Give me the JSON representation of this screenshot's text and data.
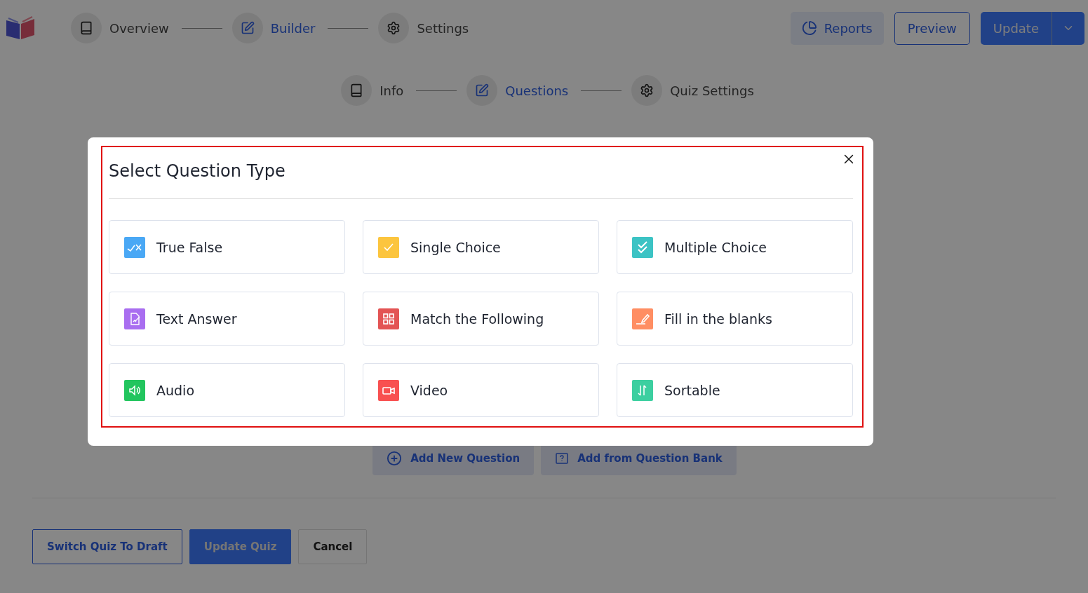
{
  "steps": [
    {
      "label": "Overview",
      "selected": false
    },
    {
      "label": "Builder",
      "selected": true
    },
    {
      "label": "Settings",
      "selected": false
    }
  ],
  "header_buttons": {
    "reports": "Reports",
    "preview": "Preview",
    "update": "Update"
  },
  "sub_steps": [
    {
      "label": "Info",
      "selected": false
    },
    {
      "label": "Questions",
      "selected": true
    },
    {
      "label": "Quiz Settings",
      "selected": false
    }
  ],
  "question_actions": [
    {
      "label": "Add New Question",
      "kind": "add"
    },
    {
      "label": "Add from Question Bank",
      "kind": "bank"
    }
  ],
  "footer_buttons": [
    {
      "label": "Switch Quiz To Draft",
      "kind": "outline"
    },
    {
      "label": "Update Quiz",
      "kind": "primary"
    },
    {
      "label": "Cancel",
      "kind": "plain"
    }
  ],
  "modal": {
    "title": "Select Question Type",
    "question_types": [
      {
        "label": "True False",
        "kind": "true_false",
        "color": "#4aa8f5"
      },
      {
        "label": "Single Choice",
        "kind": "single",
        "color": "#fcc53e"
      },
      {
        "label": "Multiple Choice",
        "kind": "multiple",
        "color": "#3cc3c4"
      },
      {
        "label": "Text Answer",
        "kind": "text",
        "color": "#a96ef0"
      },
      {
        "label": "Match the Following",
        "kind": "match",
        "color": "#e35454"
      },
      {
        "label": "Fill in the blanks",
        "kind": "fill",
        "color": "#ff8e63"
      },
      {
        "label": "Audio",
        "kind": "audio",
        "color": "#22c55e"
      },
      {
        "label": "Video",
        "kind": "video",
        "color": "#f85050"
      },
      {
        "label": "Sortable",
        "kind": "sortable",
        "color": "#3ccfa0"
      }
    ]
  }
}
